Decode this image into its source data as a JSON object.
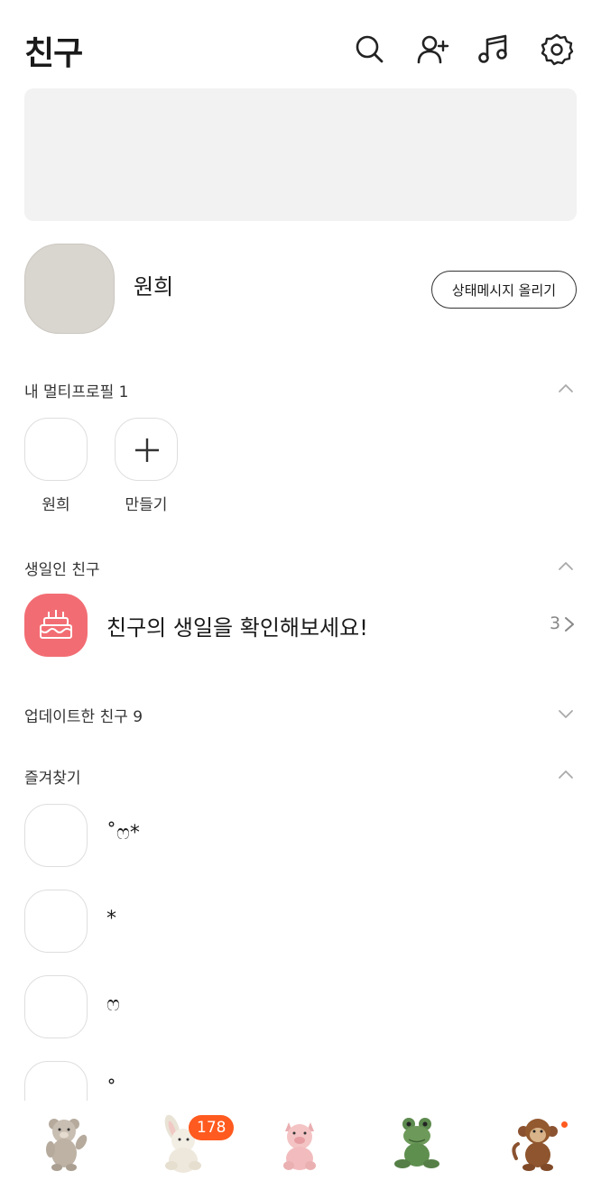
{
  "header": {
    "title": "친구",
    "icons": [
      "search-icon",
      "add-friend-icon",
      "music-icon",
      "settings-icon"
    ]
  },
  "my_profile": {
    "name": "원희",
    "status_button": "상태메시지 올리기"
  },
  "multi_profile": {
    "title": "내 멀티프로필 1",
    "items": [
      {
        "label": "원희"
      },
      {
        "label": "만들기"
      }
    ]
  },
  "birthday": {
    "title": "생일인 친구",
    "text": "친구의 생일을 확인해보세요!",
    "count": "3"
  },
  "updated": {
    "title": "업데이트한 친구 9"
  },
  "favorites": {
    "title": "즐겨찾기",
    "items": [
      {
        "name": "˚ෆ*"
      },
      {
        "name": "*"
      },
      {
        "name": "ෆ"
      },
      {
        "name": "˚"
      }
    ]
  },
  "tabbar": {
    "tabs": [
      "teddy-bear-tab",
      "bunny-tab",
      "pig-tab",
      "frog-tab",
      "monkey-tab"
    ],
    "badge": "178",
    "accent_color": "#ff5a1f"
  },
  "colors": {
    "birthday_icon_bg": "#f26d73",
    "avatar_bg": "#d9d5cf",
    "banner_bg": "#f2f2f2"
  }
}
